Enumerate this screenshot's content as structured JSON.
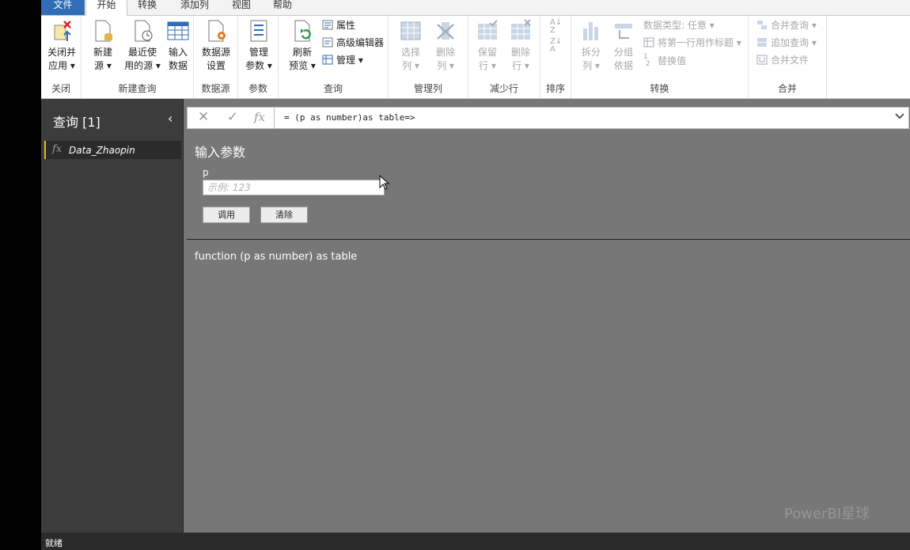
{
  "tabs": [
    "文件",
    "开始",
    "转换",
    "添加列",
    "视图",
    "帮助"
  ],
  "ribbon": {
    "close": {
      "btn1": "关闭并",
      "btn1b": "应用 ▾",
      "label": "关闭"
    },
    "newquery": {
      "new1": "新建",
      "new1b": "源 ▾",
      "recent1": "最近使",
      "recent1b": "用的源 ▾",
      "input1": "输入",
      "input1b": "数据",
      "label": "新建查询"
    },
    "datasource": {
      "btn1": "数据源",
      "btn1b": "设置",
      "label": "数据源"
    },
    "params": {
      "btn1": "管理",
      "btn1b": "参数 ▾",
      "label": "参数"
    },
    "query": {
      "refresh1": "刷新",
      "refresh1b": "预览 ▾",
      "props": "属性",
      "advanced": "高级编辑器",
      "manage": "管理 ▾",
      "label": "查询"
    },
    "managecols": {
      "choose1": "选择",
      "choose1b": "列 ▾",
      "remove1": "删除",
      "remove1b": "列 ▾",
      "label": "管理列"
    },
    "reducerows": {
      "keep1": "保留",
      "keep1b": "行 ▾",
      "remove1": "删除",
      "remove1b": "行 ▾",
      "label": "减少行"
    },
    "sort": {
      "label": "排序"
    },
    "transform": {
      "split1": "拆分",
      "split1b": "列 ▾",
      "group1": "分组",
      "group1b": "依据",
      "datatype": "数据类型: 任意 ▾",
      "firstrow": "将第一行用作标题 ▾",
      "replace": "替换值",
      "label": "转换"
    },
    "combine": {
      "merge": "合并查询 ▾",
      "append": "追加查询 ▾",
      "files": "合并文件",
      "label": "合并"
    }
  },
  "queries": {
    "title": "查询 [1]",
    "collapse": "‹",
    "items": [
      {
        "fx": "fx",
        "name": "Data_Zhaopin"
      }
    ]
  },
  "formula": {
    "cancel": "✕",
    "confirm": "✓",
    "fx": "fx",
    "text": "= (p as number)as table=>"
  },
  "params": {
    "title": "输入参数",
    "param_name": "p",
    "placeholder": "示例: 123",
    "invoke": "调用",
    "clear": "清除"
  },
  "signature": "function (p as number) as table",
  "watermark": "PowerBI星球",
  "status": "就绪",
  "colors": {
    "accent": "#e5b81f",
    "file_tab": "#2f6db6",
    "pane": "#3c3c3c",
    "content": "#777777"
  }
}
